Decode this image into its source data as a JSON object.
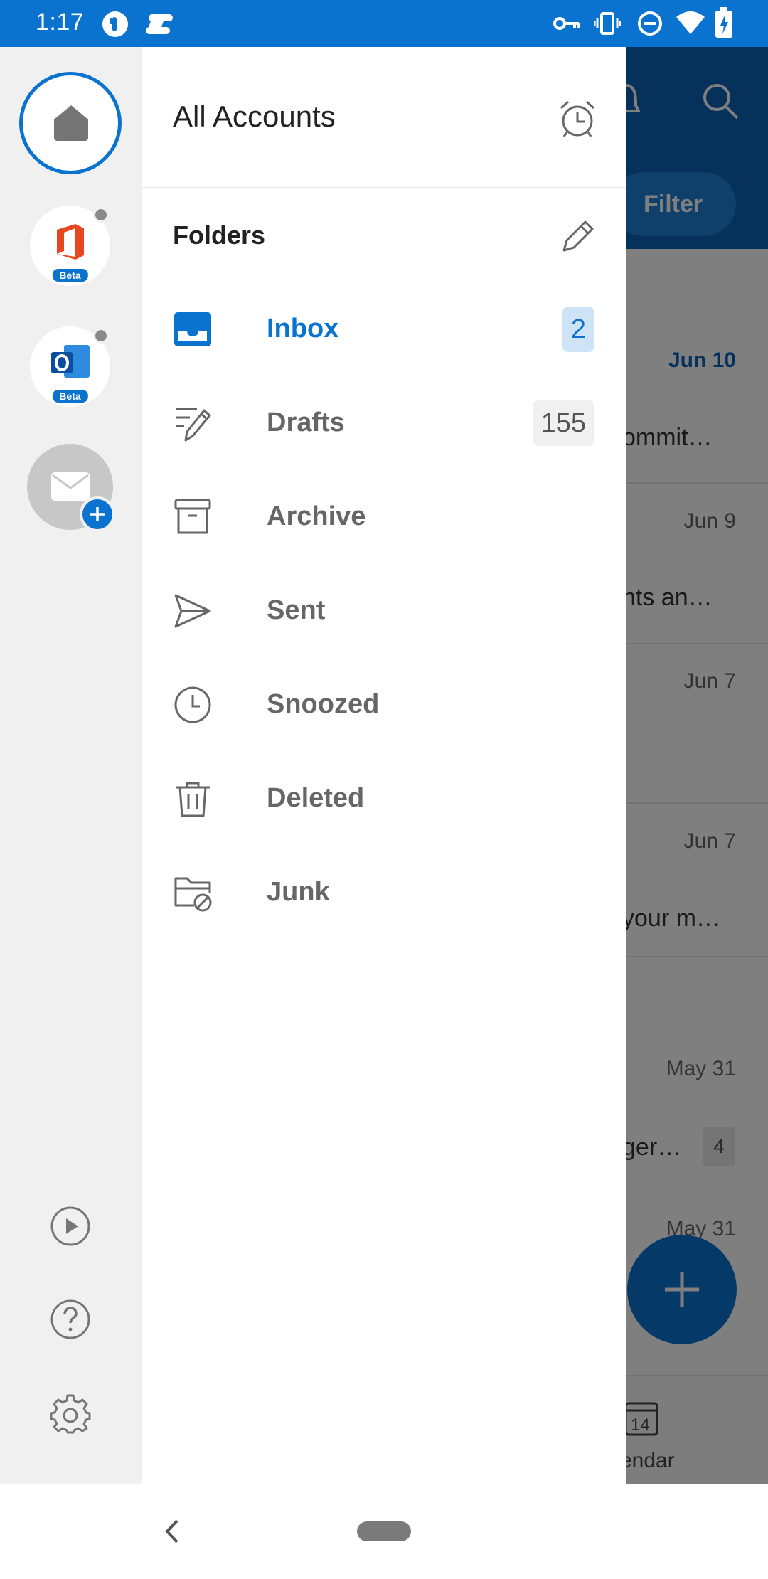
{
  "status_bar": {
    "time": "1:17",
    "bg_color": "#0a72cf",
    "icons": [
      "app-icon",
      "link-icon",
      "vpn-key-icon",
      "vibrate-icon",
      "dnd-icon",
      "wifi-icon",
      "battery-charging-icon"
    ]
  },
  "background": {
    "filter_label": "Filter",
    "rows": [
      {
        "date": "Jun 10",
        "snippet": "ommit…",
        "unread": true
      },
      {
        "date": "Jun 9",
        "snippet": "nts an…"
      },
      {
        "date": "Jun 7",
        "snippet": ""
      },
      {
        "date": "Jun 7",
        "snippet": "your m…"
      },
      {
        "date": "May 31",
        "snippet": "ger…",
        "badge": "4"
      },
      {
        "date": "May 31",
        "snippet": ""
      }
    ],
    "tab_label": "endar",
    "calendar_day": "14"
  },
  "rail": {
    "accounts": [
      {
        "name": "home-account",
        "active": true
      },
      {
        "name": "office-beta-account",
        "badge": "Beta"
      },
      {
        "name": "outlook-beta-account",
        "badge": "Beta"
      },
      {
        "name": "add-mail-account"
      }
    ]
  },
  "drawer": {
    "title": "All Accounts",
    "folders_title": "Folders",
    "folders": [
      {
        "label": "Inbox",
        "count": "2",
        "icon": "inbox-icon",
        "active": true
      },
      {
        "label": "Drafts",
        "count": "155",
        "icon": "drafts-icon"
      },
      {
        "label": "Archive",
        "count": "",
        "icon": "archive-icon"
      },
      {
        "label": "Sent",
        "count": "",
        "icon": "sent-icon"
      },
      {
        "label": "Snoozed",
        "count": "",
        "icon": "snoozed-icon"
      },
      {
        "label": "Deleted",
        "count": "",
        "icon": "trash-icon"
      },
      {
        "label": "Junk",
        "count": "",
        "icon": "junk-folder-icon"
      }
    ]
  },
  "colors": {
    "accent": "#0a72cf",
    "inbox_badge_bg": "#cfe3f7",
    "muted_text": "#666666"
  }
}
